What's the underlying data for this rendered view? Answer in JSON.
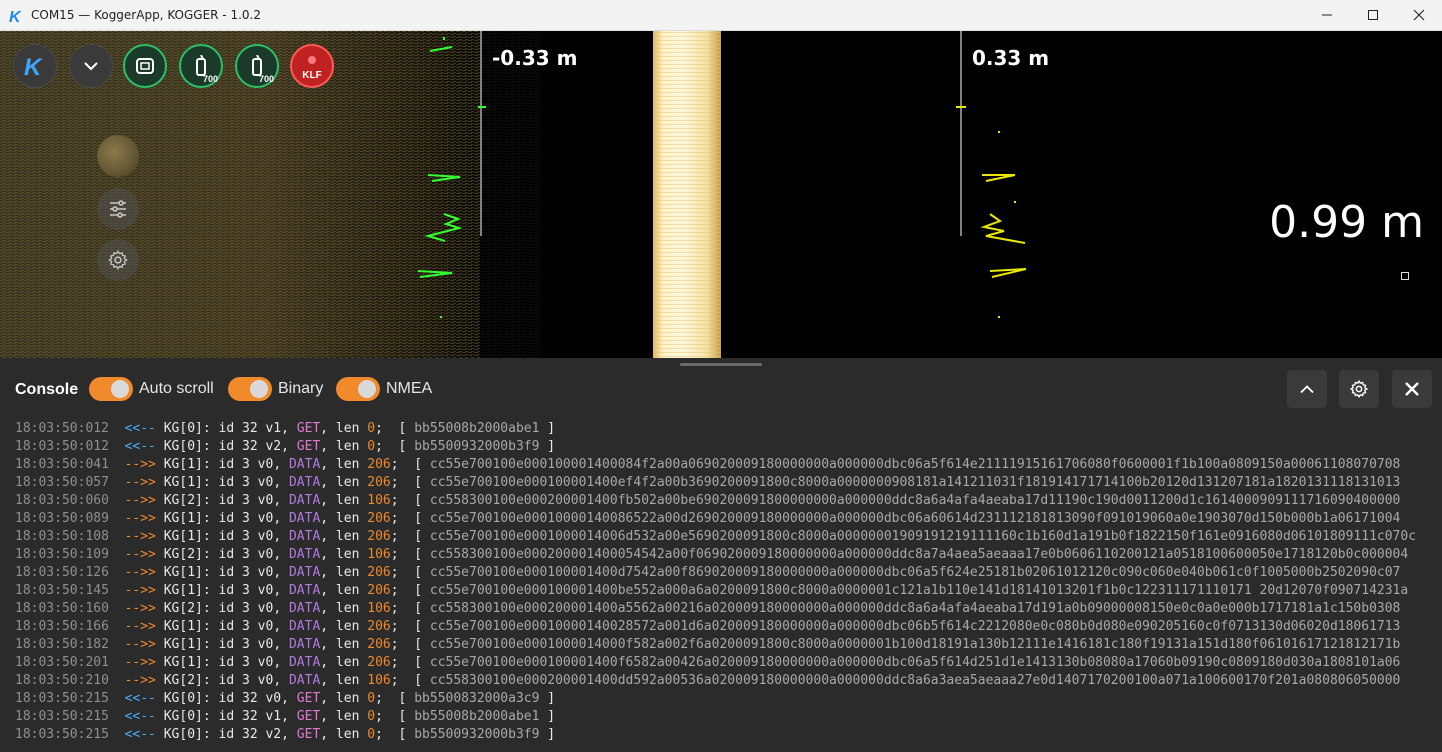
{
  "window": {
    "title": "COM15 — KoggerApp, KOGGER - 1.0.2",
    "logo_letter": "K"
  },
  "echogram": {
    "left_depth": "-0.33 m",
    "right_depth": "0.33 m",
    "depth_reading": "0.99 m",
    "toolbar": {
      "sensor_1_badge": "700",
      "sensor_2_badge": "700",
      "record_label": "KLF"
    }
  },
  "console": {
    "title": "Console",
    "toggles": [
      {
        "label": "Auto scroll",
        "on": true
      },
      {
        "label": "Binary",
        "on": true
      },
      {
        "label": "NMEA",
        "on": true
      }
    ],
    "colors": {
      "toggle_on": "#f08a2a",
      "incoming": "#4ab0ff",
      "outgoing": "#f08a2a"
    },
    "lines": [
      {
        "ts": "18:03:50:012",
        "dir": "<<--",
        "dev": "KG[0]",
        "id": "id 32 v1",
        "method": "GET",
        "len": "0",
        "payload": "bb55008b2000abe1"
      },
      {
        "ts": "18:03:50:012",
        "dir": "<<--",
        "dev": "KG[0]",
        "id": "id 32 v2",
        "method": "GET",
        "len": "0",
        "payload": "bb5500932000b3f9"
      },
      {
        "ts": "18:03:50:041",
        "dir": "-->>",
        "dev": "KG[1]",
        "id": "id 3 v0",
        "method": "DATA",
        "len": "206",
        "payload": "cc55e700100e000100001400084f2a00a069020009180000000a000000dbc06a5f614e21111915161706080f0600001f1b100a0809150a00061108070708"
      },
      {
        "ts": "18:03:50:057",
        "dir": "-->>",
        "dev": "KG[1]",
        "id": "id 3 v0",
        "method": "DATA",
        "len": "206",
        "payload": "cc55e700100e000100001400ef4f2a00b3690200091800c8000a0000000908181a141211031f181914171714100b20120d131207181a1820131118131013"
      },
      {
        "ts": "18:03:50:060",
        "dir": "-->>",
        "dev": "KG[2]",
        "id": "id 3 v0",
        "method": "DATA",
        "len": "106",
        "payload": "cc558300100e000200001400fb502a00be690200091800000000a000000ddc8a6a4afa4aeaba17d11190c190d0011200d1c1614000909111716090400000"
      },
      {
        "ts": "18:03:50:089",
        "dir": "-->>",
        "dev": "KG[1]",
        "id": "id 3 v0",
        "method": "DATA",
        "len": "206",
        "payload": "cc55e700100e00010000140086522a00d269020009180000000a000000dbc06a60614d231112181813090f091019060a0e1903070d150b000b1a06171004"
      },
      {
        "ts": "18:03:50:108",
        "dir": "-->>",
        "dev": "KG[1]",
        "id": "id 3 v0",
        "method": "DATA",
        "len": "206",
        "payload": "cc55e700100e0001000014006d532a00e5690200091800c8000a00000001909191219111160c1b160d1a191b0f1822150f161e0916080d06101809111c070c"
      },
      {
        "ts": "18:03:50:109",
        "dir": "-->>",
        "dev": "KG[2]",
        "id": "id 3 v0",
        "method": "DATA",
        "len": "106",
        "payload": "cc558300100e000200001400054542a00f069020009180000000a000000ddc8a7a4aea5aeaaa17e0b0606110200121a0518100600050e1718120b0c000004"
      },
      {
        "ts": "18:03:50:126",
        "dir": "-->>",
        "dev": "KG[1]",
        "id": "id 3 v0",
        "method": "DATA",
        "len": "206",
        "payload": "cc55e700100e000100001400d7542a00f869020009180000000a000000dbc06a5f624e25181b02061012120c090c060e040b061c0f1005000b2502090c07"
      },
      {
        "ts": "18:03:50:145",
        "dir": "-->>",
        "dev": "KG[1]",
        "id": "id 3 v0",
        "method": "DATA",
        "len": "206",
        "payload": "cc55e700100e000100001400be552a000a6a0200091800c8000a0000001c121a1b110e141d18141013201f1b0c122311171110171 20d12070f090714231a"
      },
      {
        "ts": "18:03:50:160",
        "dir": "-->>",
        "dev": "KG[2]",
        "id": "id 3 v0",
        "method": "DATA",
        "len": "106",
        "payload": "cc558300100e000200001400a5562a00216a020009180000000a000000ddc8a6a4afa4aeaba17d191a0b09000008150e0c0a0e000b1717181a1c150b0308"
      },
      {
        "ts": "18:03:50:166",
        "dir": "-->>",
        "dev": "KG[1]",
        "id": "id 3 v0",
        "method": "DATA",
        "len": "206",
        "payload": "cc55e700100e00010000140028572a001d6a020009180000000a000000dbc06b5f614c2212080e0c080b0d080e090205160c0f0713130d06020d18061713"
      },
      {
        "ts": "18:03:50:182",
        "dir": "-->>",
        "dev": "KG[1]",
        "id": "id 3 v0",
        "method": "DATA",
        "len": "206",
        "payload": "cc55e700100e0001000014000f582a002f6a0200091800c8000a0000001b100d18191a130b12111e1416181c180f19131a151d180f06101617121812171b"
      },
      {
        "ts": "18:03:50:201",
        "dir": "-->>",
        "dev": "KG[1]",
        "id": "id 3 v0",
        "method": "DATA",
        "len": "206",
        "payload": "cc55e700100e000100001400f6582a00426a020009180000000a000000dbc06a5f614d251d1e1413130b08080a17060b09190c0809180d030a1808101a06"
      },
      {
        "ts": "18:03:50:210",
        "dir": "-->>",
        "dev": "KG[2]",
        "id": "id 3 v0",
        "method": "DATA",
        "len": "106",
        "payload": "cc558300100e000200001400dd592a00536a020009180000000a000000ddc8a6a3aea5aeaaa27e0d1407170200100a071a100600170f201a080806050000"
      },
      {
        "ts": "18:03:50:215",
        "dir": "<<--",
        "dev": "KG[0]",
        "id": "id 32 v0",
        "method": "GET",
        "len": "0",
        "payload": "bb5500832000a3c9"
      },
      {
        "ts": "18:03:50:215",
        "dir": "<<--",
        "dev": "KG[0]",
        "id": "id 32 v1",
        "method": "GET",
        "len": "0",
        "payload": "bb55008b2000abe1"
      },
      {
        "ts": "18:03:50:215",
        "dir": "<<--",
        "dev": "KG[0]",
        "id": "id 32 v2",
        "method": "GET",
        "len": "0",
        "payload": "bb5500932000b3f9"
      }
    ]
  }
}
